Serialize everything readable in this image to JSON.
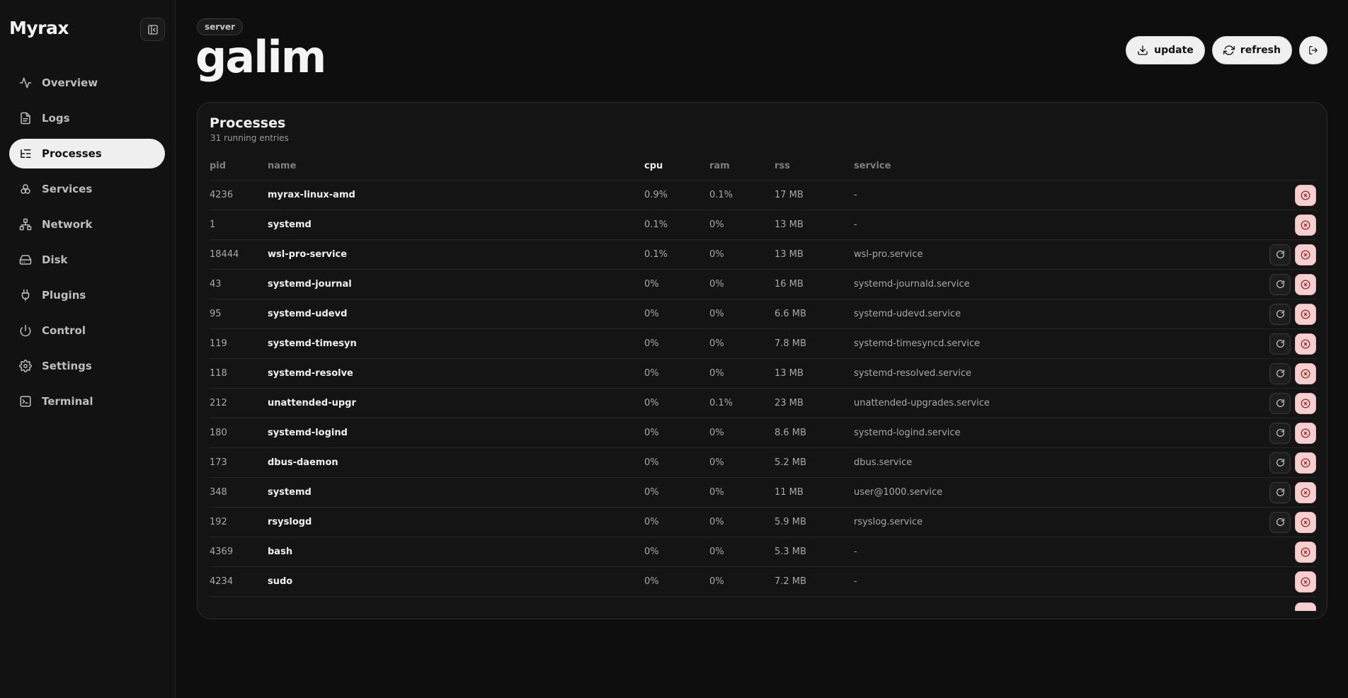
{
  "app": {
    "logo": "Myrax"
  },
  "sidebar": {
    "items": [
      {
        "label": "Overview",
        "icon": "activity-icon",
        "active": false
      },
      {
        "label": "Logs",
        "icon": "file-icon",
        "active": false
      },
      {
        "label": "Processes",
        "icon": "list-tree-icon",
        "active": true
      },
      {
        "label": "Services",
        "icon": "boxes-icon",
        "active": false
      },
      {
        "label": "Network",
        "icon": "network-icon",
        "active": false
      },
      {
        "label": "Disk",
        "icon": "hard-drive-icon",
        "active": false
      },
      {
        "label": "Plugins",
        "icon": "plug-icon",
        "active": false
      },
      {
        "label": "Control",
        "icon": "power-icon",
        "active": false
      },
      {
        "label": "Settings",
        "icon": "gear-icon",
        "active": false
      },
      {
        "label": "Terminal",
        "icon": "terminal-icon",
        "active": false
      }
    ]
  },
  "header": {
    "badge": "server",
    "title": "galim",
    "update_label": "update",
    "refresh_label": "refresh"
  },
  "processes": {
    "title": "Processes",
    "subtitle": "31 running entries",
    "columns": {
      "pid": "pid",
      "name": "name",
      "cpu": "cpu",
      "ram": "ram",
      "rss": "rss",
      "service": "service"
    },
    "rows": [
      {
        "pid": "4236",
        "name": "myrax-linux-amd",
        "cpu": "0.9%",
        "ram": "0.1%",
        "rss": "17 MB",
        "service": "-",
        "restartable": false
      },
      {
        "pid": "1",
        "name": "systemd",
        "cpu": "0.1%",
        "ram": "0%",
        "rss": "13 MB",
        "service": "-",
        "restartable": false
      },
      {
        "pid": "18444",
        "name": "wsl-pro-service",
        "cpu": "0.1%",
        "ram": "0%",
        "rss": "13 MB",
        "service": "wsl-pro.service",
        "restartable": true
      },
      {
        "pid": "43",
        "name": "systemd-journal",
        "cpu": "0%",
        "ram": "0%",
        "rss": "16 MB",
        "service": "systemd-journald.service",
        "restartable": true
      },
      {
        "pid": "95",
        "name": "systemd-udevd",
        "cpu": "0%",
        "ram": "0%",
        "rss": "6.6 MB",
        "service": "systemd-udevd.service",
        "restartable": true
      },
      {
        "pid": "119",
        "name": "systemd-timesyn",
        "cpu": "0%",
        "ram": "0%",
        "rss": "7.8 MB",
        "service": "systemd-timesyncd.service",
        "restartable": true
      },
      {
        "pid": "118",
        "name": "systemd-resolve",
        "cpu": "0%",
        "ram": "0%",
        "rss": "13 MB",
        "service": "systemd-resolved.service",
        "restartable": true
      },
      {
        "pid": "212",
        "name": "unattended-upgr",
        "cpu": "0%",
        "ram": "0.1%",
        "rss": "23 MB",
        "service": "unattended-upgrades.service",
        "restartable": true
      },
      {
        "pid": "180",
        "name": "systemd-logind",
        "cpu": "0%",
        "ram": "0%",
        "rss": "8.6 MB",
        "service": "systemd-logind.service",
        "restartable": true
      },
      {
        "pid": "173",
        "name": "dbus-daemon",
        "cpu": "0%",
        "ram": "0%",
        "rss": "5.2 MB",
        "service": "dbus.service",
        "restartable": true
      },
      {
        "pid": "348",
        "name": "systemd",
        "cpu": "0%",
        "ram": "0%",
        "rss": "11 MB",
        "service": "user@1000.service",
        "restartable": true
      },
      {
        "pid": "192",
        "name": "rsyslogd",
        "cpu": "0%",
        "ram": "0%",
        "rss": "5.9 MB",
        "service": "rsyslog.service",
        "restartable": true
      },
      {
        "pid": "4369",
        "name": "bash",
        "cpu": "0%",
        "ram": "0%",
        "rss": "5.3 MB",
        "service": "-",
        "restartable": false
      },
      {
        "pid": "4234",
        "name": "sudo",
        "cpu": "0%",
        "ram": "0%",
        "rss": "7.2 MB",
        "service": "-",
        "restartable": false
      }
    ]
  },
  "colors": {
    "background": "#0e0e0e",
    "sidebar": "#121212",
    "active_nav": "#efefef",
    "kill_button": "#f6d0d0",
    "kill_icon": "#9a2b2b"
  }
}
